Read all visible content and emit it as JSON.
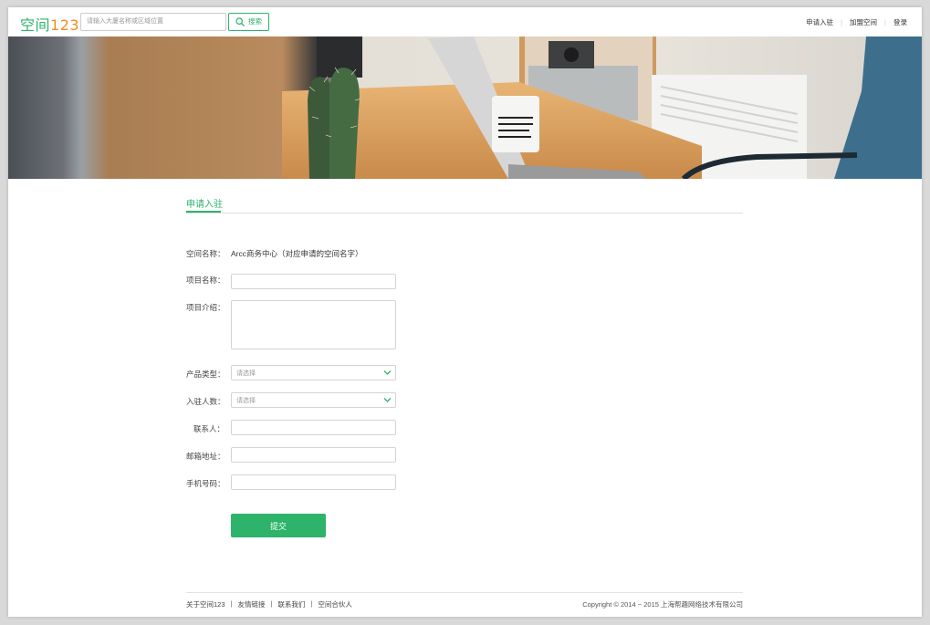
{
  "header": {
    "logo_main": "空间",
    "logo_num": "123",
    "search_placeholder": "请输入大厦名称或区域位置",
    "search_label": "搜索",
    "nav": [
      "申请入驻",
      "加盟空间",
      "登录"
    ]
  },
  "section": {
    "tab_label": "申请入驻"
  },
  "form": {
    "space_name_label": "空间名称：",
    "space_name_value": "Arcc商务中心（对应申请的空间名字）",
    "project_name_label": "项目名称：",
    "project_intro_label": "项目介绍：",
    "product_type_label": "产品类型：",
    "product_type_value": "请选择",
    "headcount_label": "入驻人数：",
    "headcount_value": "请选择",
    "contact_label": "联系人：",
    "email_label": "邮箱地址：",
    "phone_label": "手机号码：",
    "submit_label": "提交"
  },
  "footer": {
    "links": [
      "关于空间123",
      "友情链接",
      "联系我们",
      "空间合伙人"
    ],
    "copyright": "Copyright © 2014 ~ 2015 上海帮趣网络技术有限公司"
  },
  "colors": {
    "accent": "#2db36a",
    "logo_num": "#f08c1e"
  }
}
